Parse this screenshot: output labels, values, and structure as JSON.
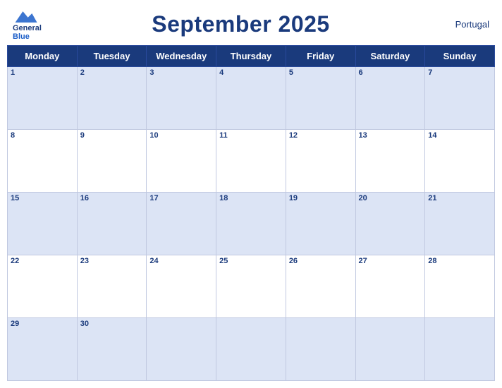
{
  "header": {
    "title": "September 2025",
    "country": "Portugal",
    "logo_line1": "General",
    "logo_line2": "Blue"
  },
  "days": [
    "Monday",
    "Tuesday",
    "Wednesday",
    "Thursday",
    "Friday",
    "Saturday",
    "Sunday"
  ],
  "weeks": [
    {
      "shaded": true,
      "cells": [
        {
          "date": "1",
          "empty": false
        },
        {
          "date": "2",
          "empty": false
        },
        {
          "date": "3",
          "empty": false
        },
        {
          "date": "4",
          "empty": false
        },
        {
          "date": "5",
          "empty": false
        },
        {
          "date": "6",
          "empty": false
        },
        {
          "date": "7",
          "empty": false
        }
      ]
    },
    {
      "shaded": false,
      "cells": [
        {
          "date": "8",
          "empty": false
        },
        {
          "date": "9",
          "empty": false
        },
        {
          "date": "10",
          "empty": false
        },
        {
          "date": "11",
          "empty": false
        },
        {
          "date": "12",
          "empty": false
        },
        {
          "date": "13",
          "empty": false
        },
        {
          "date": "14",
          "empty": false
        }
      ]
    },
    {
      "shaded": true,
      "cells": [
        {
          "date": "15",
          "empty": false
        },
        {
          "date": "16",
          "empty": false
        },
        {
          "date": "17",
          "empty": false
        },
        {
          "date": "18",
          "empty": false
        },
        {
          "date": "19",
          "empty": false
        },
        {
          "date": "20",
          "empty": false
        },
        {
          "date": "21",
          "empty": false
        }
      ]
    },
    {
      "shaded": false,
      "cells": [
        {
          "date": "22",
          "empty": false
        },
        {
          "date": "23",
          "empty": false
        },
        {
          "date": "24",
          "empty": false
        },
        {
          "date": "25",
          "empty": false
        },
        {
          "date": "26",
          "empty": false
        },
        {
          "date": "27",
          "empty": false
        },
        {
          "date": "28",
          "empty": false
        }
      ]
    },
    {
      "shaded": true,
      "cells": [
        {
          "date": "29",
          "empty": false
        },
        {
          "date": "30",
          "empty": false
        },
        {
          "date": "",
          "empty": true
        },
        {
          "date": "",
          "empty": true
        },
        {
          "date": "",
          "empty": true
        },
        {
          "date": "",
          "empty": true
        },
        {
          "date": "",
          "empty": true
        }
      ]
    }
  ]
}
